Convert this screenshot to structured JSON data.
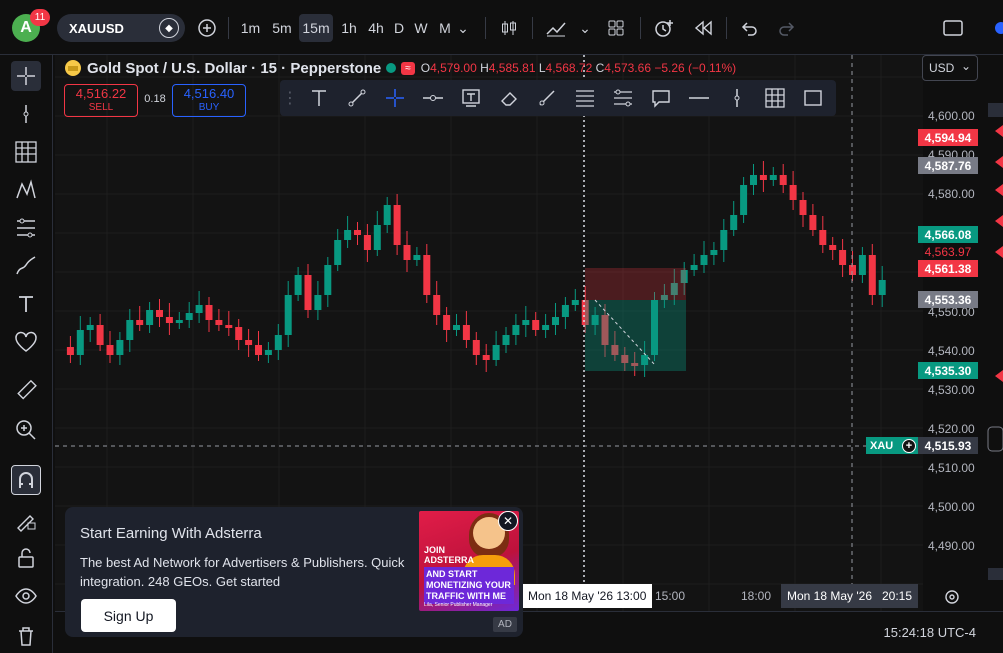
{
  "topbar": {
    "avatar_letter": "A",
    "notifications": "11",
    "symbol": "XAUUSD",
    "timeframes": [
      "1m",
      "5m",
      "15m",
      "1h",
      "4h",
      "D",
      "W",
      "M"
    ],
    "active_timeframe": "15m"
  },
  "header": {
    "title": "Gold Spot / U.S. Dollar · 15 · Pepperstone",
    "o_label": "O",
    "o": "4,579.00",
    "h_label": "H",
    "h": "4,585.81",
    "l_label": "L",
    "l": "4,568.72",
    "c_label": "C",
    "c": "4,573.66",
    "change": "−5.26 (−0.11%)"
  },
  "trade": {
    "sell_price": "4,516.22",
    "sell_label": "SELL",
    "spread": "0.18",
    "buy_price": "4,516.40",
    "buy_label": "BUY"
  },
  "currency": "USD",
  "price_ticks": [
    "4,600.00",
    "4,590.00",
    "4,580.00",
    "4,550.00",
    "4,540.00",
    "4,530.00",
    "4,520.00",
    "4,510.00",
    "4,500.00",
    "4,490.00"
  ],
  "price_labels": {
    "p1": "4,594.94",
    "p2": "4,587.76",
    "p3": "4,566.08",
    "p4": "4,563.97",
    "p5": "4,561.38",
    "p6": "4,553.36",
    "p7": "4,535.30",
    "p8": "4,515.93",
    "sym_tag": "XAU"
  },
  "time_axis": {
    "crosshair_left": "Mon 18 May '26   13:00",
    "t1": "15:00",
    "t2": "18:00",
    "crosshair_right": "Mon 18 May '26   20:15"
  },
  "clock": "15:24:18 UTC-4",
  "ad": {
    "title": "Start Earning With Adsterra",
    "body": "The best Ad Network for Advertisers & Publishers. Quick integration. 248 GEOs. Get started",
    "button": "Sign Up",
    "img_text1": "JOIN ADSTERRA",
    "img_text2": "AND START MONETIZING YOUR TRAFFIC WITH ME",
    "img_text3": "Lila, Senior Publisher Manager",
    "tag": "AD"
  },
  "colors": {
    "up": "#089981",
    "down": "#f23645",
    "buy": "#2962ff"
  }
}
